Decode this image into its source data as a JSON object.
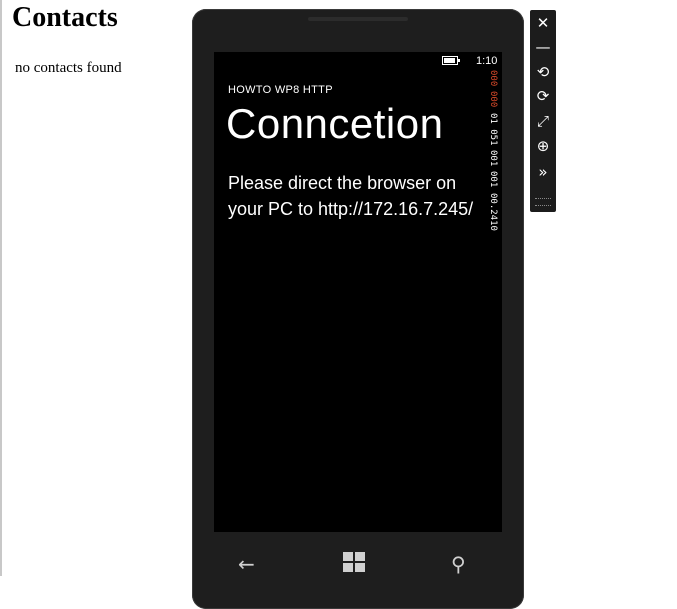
{
  "page": {
    "heading": "Contacts",
    "message": "no contacts found"
  },
  "phone": {
    "status": {
      "time": "1:10",
      "battery_icon": "battery-icon"
    },
    "app_title": "HOWTO WP8 HTTP",
    "page_title": "Conncetion",
    "instruction": "Please direct the browser on your PC to http://172.16.7.245/",
    "frame_counters": [
      {
        "value": "000",
        "color": "#d84a2a"
      },
      {
        "value": "000",
        "color": "#d84a2a"
      },
      {
        "value": "01 051",
        "color": "#ffffff"
      },
      {
        "value": "001",
        "color": "#ffffff"
      },
      {
        "value": "001",
        "color": "#ffffff"
      },
      {
        "value": "00.2410",
        "color": "#ffffff"
      }
    ],
    "nav": {
      "back_glyph": "←",
      "back_icon": "back-arrow-icon",
      "start_icon": "windows-logo-icon",
      "search_glyph": "⚲",
      "search_icon": "search-icon"
    }
  },
  "emulator_toolbar": [
    {
      "name": "close-icon",
      "glyph": "✕"
    },
    {
      "name": "minimize-icon",
      "glyph": "—"
    },
    {
      "name": "rotate-left-icon",
      "glyph": "⟲"
    },
    {
      "name": "rotate-right-icon",
      "glyph": "⟳"
    },
    {
      "name": "fit-to-screen-icon",
      "glyph": "⤢"
    },
    {
      "name": "zoom-icon",
      "glyph": "⊕"
    },
    {
      "name": "additional-tools-icon",
      "glyph": "»"
    }
  ]
}
